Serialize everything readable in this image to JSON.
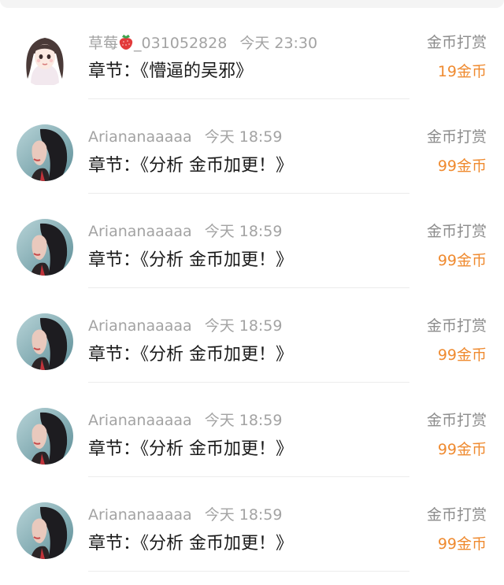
{
  "rows": [
    {
      "username": "草莓",
      "username_suffix": "_031052828",
      "username_emoji": "strawberry-icon",
      "time": "今天 23:30",
      "chapter": "章节：《懵逼的吴邪》",
      "tip_type": "金币打赏",
      "amount": "19金币",
      "avatar": "girl-illustration-avatar"
    },
    {
      "username": "Arianana­aaaa",
      "time": "今天 18:59",
      "chapter": "章节：《分析 金币加更！》",
      "tip_type": "金币打赏",
      "amount": "99金币",
      "avatar": "woman-photo-avatar"
    },
    {
      "username": "Ariananaaaaa",
      "time": "今天 18:59",
      "chapter": "章节：《分析 金币加更！》",
      "tip_type": "金币打赏",
      "amount": "99金币",
      "avatar": "woman-photo-avatar"
    },
    {
      "username": "Ariananaaaaa",
      "time": "今天 18:59",
      "chapter": "章节：《分析 金币加更！》",
      "tip_type": "金币打赏",
      "amount": "99金币",
      "avatar": "woman-photo-avatar"
    },
    {
      "username": "Ariananaaaaa",
      "time": "今天 18:59",
      "chapter": "章节：《分析 金币加更！》",
      "tip_type": "金币打赏",
      "amount": "99金币",
      "avatar": "woman-photo-avatar"
    },
    {
      "username": "Ariananaaaaa",
      "time": "今天 18:59",
      "chapter": "章节：《分析 金币加更！》",
      "tip_type": "金币打赏",
      "amount": "99金币",
      "avatar": "woman-photo-avatar"
    }
  ],
  "colors": {
    "name": "#a3a3a3",
    "chapter": "#1a1a1a",
    "tip_type": "#8c8c8c",
    "amount": "#ef8a2f"
  }
}
